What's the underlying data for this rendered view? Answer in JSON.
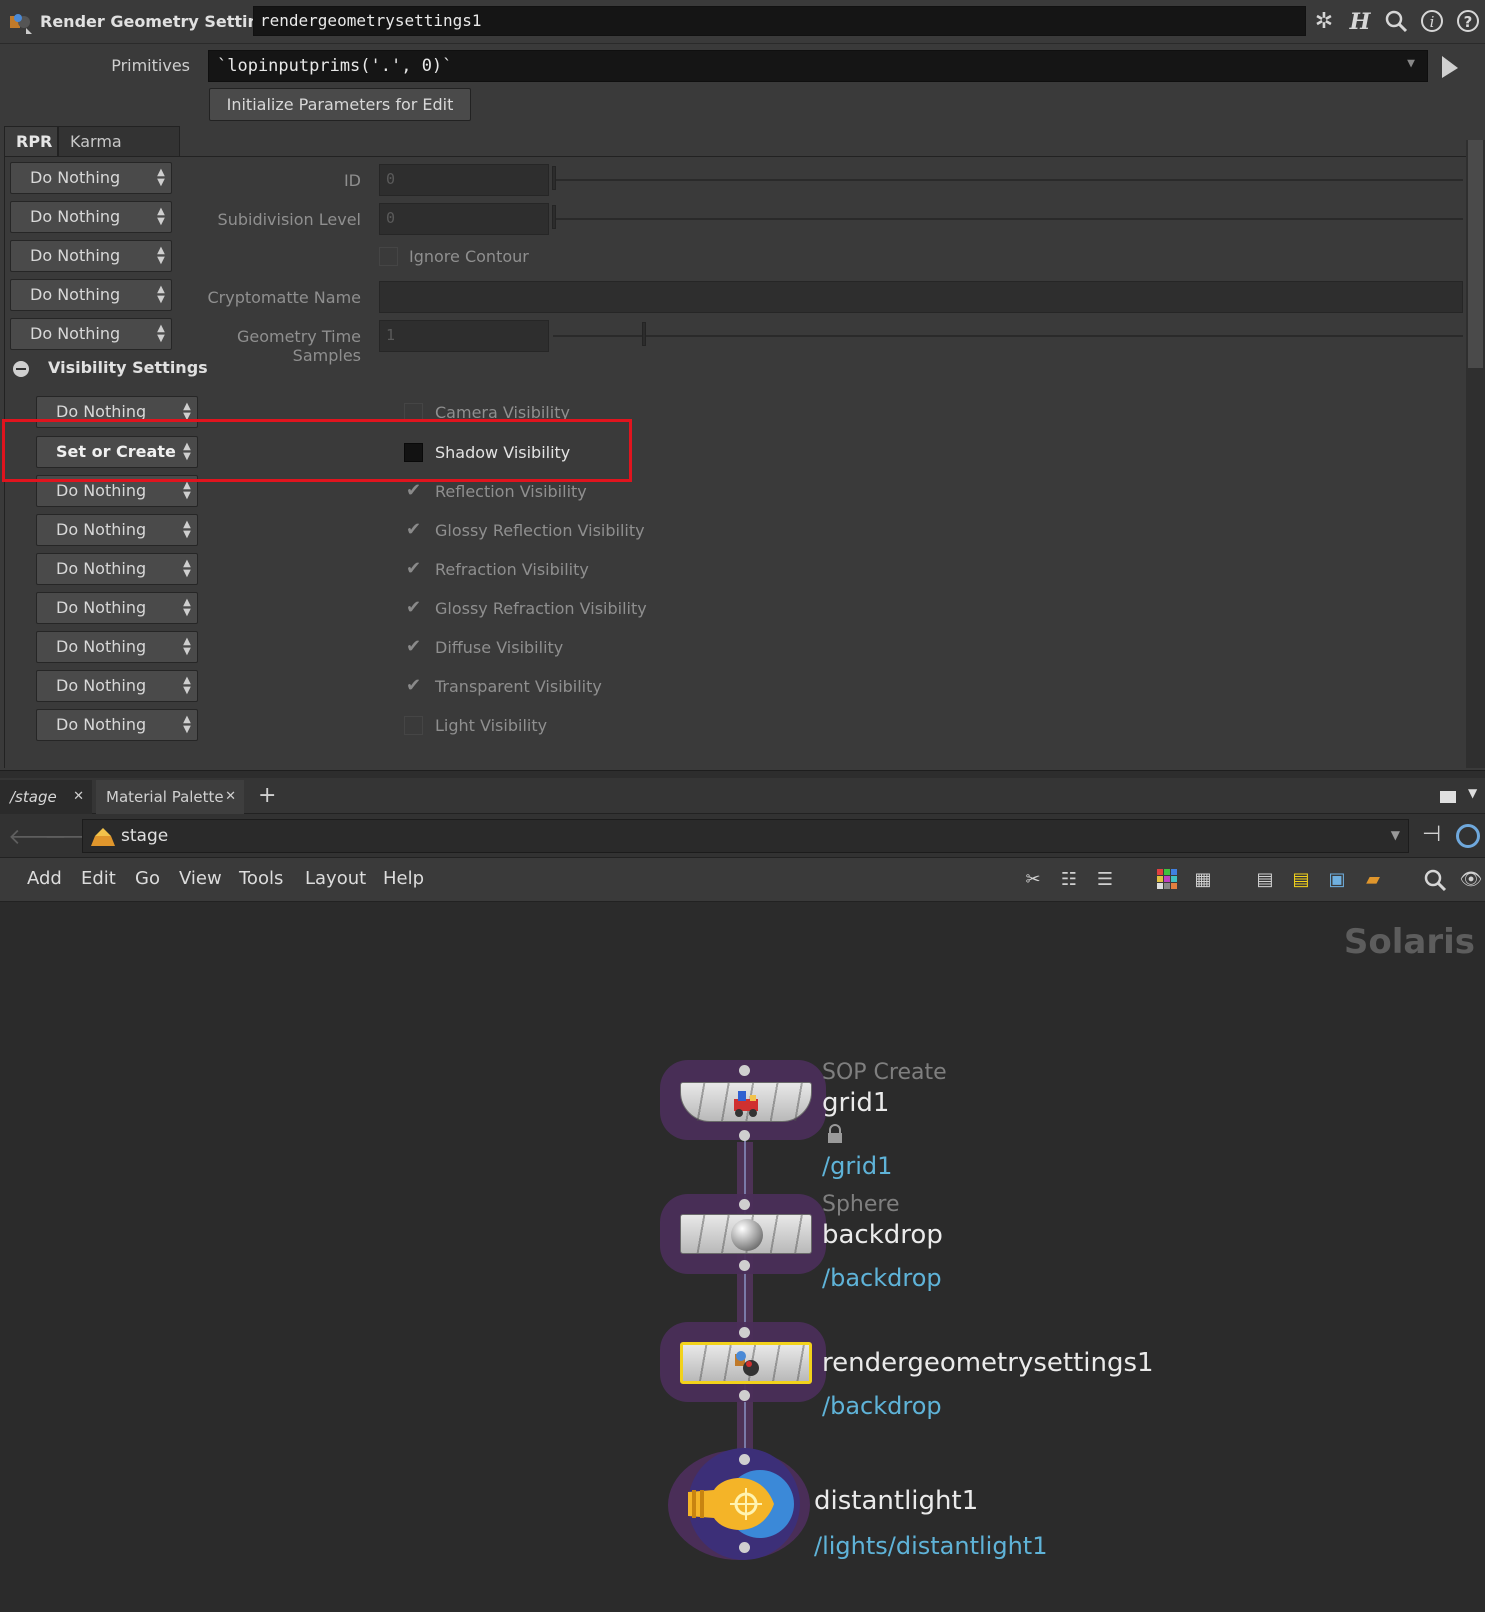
{
  "title_bar": {
    "node_type": "Render Geometry Settings",
    "node_name": "rendergeometrysettings1",
    "icons": [
      "gear-icon",
      "houdini-help-icon",
      "search-icon",
      "info-icon",
      "question-icon"
    ]
  },
  "params": {
    "primitives_label": "Primitives",
    "primitives_value": "`lopinputprims('.', 0)`",
    "init_button": "Initialize Parameters for Edit",
    "tabs": [
      "RPR",
      "Karma (Beta)"
    ],
    "rows": [
      {
        "action": "Do Nothing",
        "label": "ID",
        "value": "0"
      },
      {
        "action": "Do Nothing",
        "label": "Subidivision Level",
        "value": "0"
      },
      {
        "action": "Do Nothing",
        "label": "Ignore Contour"
      },
      {
        "action": "Do Nothing",
        "label": "Cryptomatte Name",
        "value": ""
      },
      {
        "action": "Do Nothing",
        "label": "Geometry Time Samples",
        "value": "1"
      }
    ],
    "visibility_header": "Visibility Settings",
    "visibility_rows": [
      {
        "action": "Do Nothing",
        "label": "Camera Visibility",
        "state": "off"
      },
      {
        "action": "Set or Create",
        "label": "Shadow Visibility",
        "state": "on"
      },
      {
        "action": "Do Nothing",
        "label": "Reflection Visibility",
        "state": "tick"
      },
      {
        "action": "Do Nothing",
        "label": "Glossy Reflection Visibility",
        "state": "tick"
      },
      {
        "action": "Do Nothing",
        "label": "Refraction Visibility",
        "state": "tick"
      },
      {
        "action": "Do Nothing",
        "label": "Glossy Refraction Visibility",
        "state": "tick"
      },
      {
        "action": "Do Nothing",
        "label": "Diffuse Visibility",
        "state": "tick"
      },
      {
        "action": "Do Nothing",
        "label": "Transparent Visibility",
        "state": "tick"
      },
      {
        "action": "Do Nothing",
        "label": "Light Visibility",
        "state": "off"
      }
    ]
  },
  "network": {
    "tabs": [
      "/stage",
      "Material Palette"
    ],
    "path": "stage",
    "menu": [
      "Add",
      "Edit",
      "Go",
      "View",
      "Tools",
      "Layout",
      "Help"
    ],
    "context_label": "Solaris",
    "nodes": [
      {
        "type": "SOP Create",
        "name": "grid1",
        "path": "/grid1"
      },
      {
        "type": "Sphere",
        "name": "backdrop",
        "path": "/backdrop"
      },
      {
        "type": "",
        "name": "rendergeometrysettings1",
        "path": "/backdrop"
      },
      {
        "type": "",
        "name": "distantlight1",
        "path": "/lights/distantlight1"
      }
    ]
  },
  "colors": {
    "highlight": "#e0141e",
    "selected_node": "#f2d21b",
    "path_text": "#5fb3d8",
    "node_halo": "#4a2e58"
  }
}
